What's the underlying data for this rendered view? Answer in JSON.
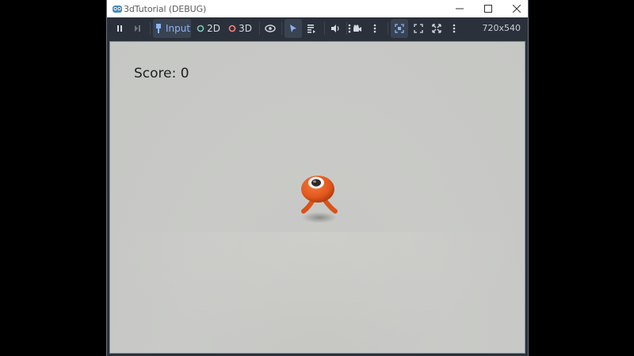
{
  "window": {
    "title": "3dTutorial (DEBUG)"
  },
  "toolbar": {
    "input_label": "Input",
    "mode_2d_label": "2D",
    "mode_3d_label": "3D",
    "resolution": "720x540",
    "icons": [
      "pause-icon",
      "step-frame-icon",
      "input-icon",
      "2d-icon",
      "3d-icon",
      "eye-icon",
      "select-cursor-icon",
      "list-icon",
      "speaker-icon",
      "more-icon",
      "camera-icon",
      "more-icon",
      "fixed-camera-icon",
      "expand-icon",
      "fullscreen-icon",
      "more-icon"
    ]
  },
  "game": {
    "score_text": "Score: 0"
  },
  "colors": {
    "toolbar_bg": "#2b313b",
    "accent": "#8ab4f8",
    "viewport_bg": "#c7c8c5",
    "player_orange": "#e4571c"
  }
}
